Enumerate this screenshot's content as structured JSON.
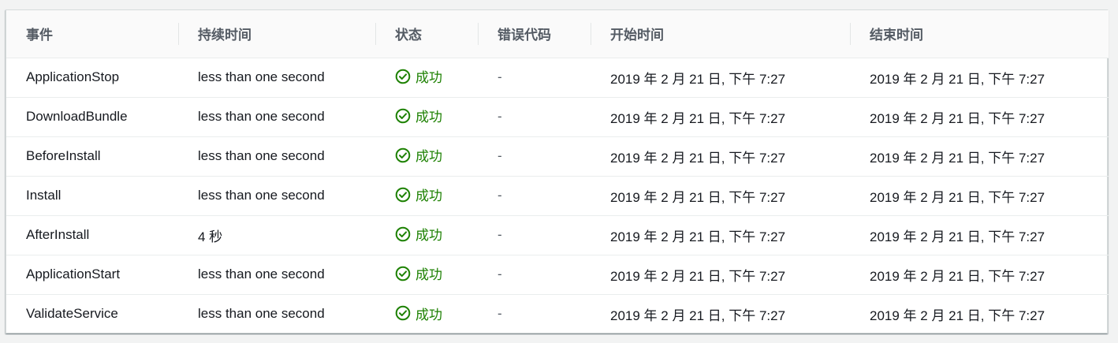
{
  "columns": [
    "事件",
    "持续时间",
    "状态",
    "错误代码",
    "开始时间",
    "结束时间"
  ],
  "rows": [
    {
      "event": "ApplicationStop",
      "duration": "less than one second",
      "status": "成功",
      "error_code": "-",
      "start": "2019 年 2 月 21 日, 下午 7:27",
      "end": "2019 年 2 月 21 日, 下午 7:27"
    },
    {
      "event": "DownloadBundle",
      "duration": "less than one second",
      "status": "成功",
      "error_code": "-",
      "start": "2019 年 2 月 21 日, 下午 7:27",
      "end": "2019 年 2 月 21 日, 下午 7:27"
    },
    {
      "event": "BeforeInstall",
      "duration": "less than one second",
      "status": "成功",
      "error_code": "-",
      "start": "2019 年 2 月 21 日, 下午 7:27",
      "end": "2019 年 2 月 21 日, 下午 7:27"
    },
    {
      "event": "Install",
      "duration": "less than one second",
      "status": "成功",
      "error_code": "-",
      "start": "2019 年 2 月 21 日, 下午 7:27",
      "end": "2019 年 2 月 21 日, 下午 7:27"
    },
    {
      "event": "AfterInstall",
      "duration": "4 秒",
      "status": "成功",
      "error_code": "-",
      "start": "2019 年 2 月 21 日, 下午 7:27",
      "end": "2019 年 2 月 21 日, 下午 7:27"
    },
    {
      "event": "ApplicationStart",
      "duration": "less than one second",
      "status": "成功",
      "error_code": "-",
      "start": "2019 年 2 月 21 日, 下午 7:27",
      "end": "2019 年 2 月 21 日, 下午 7:27"
    },
    {
      "event": "ValidateService",
      "duration": "less than one second",
      "status": "成功",
      "error_code": "-",
      "start": "2019 年 2 月 21 日, 下午 7:27",
      "end": "2019 年 2 月 21 日, 下午 7:27"
    }
  ],
  "colors": {
    "success": "#1d8102",
    "header_text": "#545b64",
    "body_text": "#16191f",
    "border": "#eaeded"
  },
  "icons": {
    "status_success": "check-circle-icon"
  }
}
